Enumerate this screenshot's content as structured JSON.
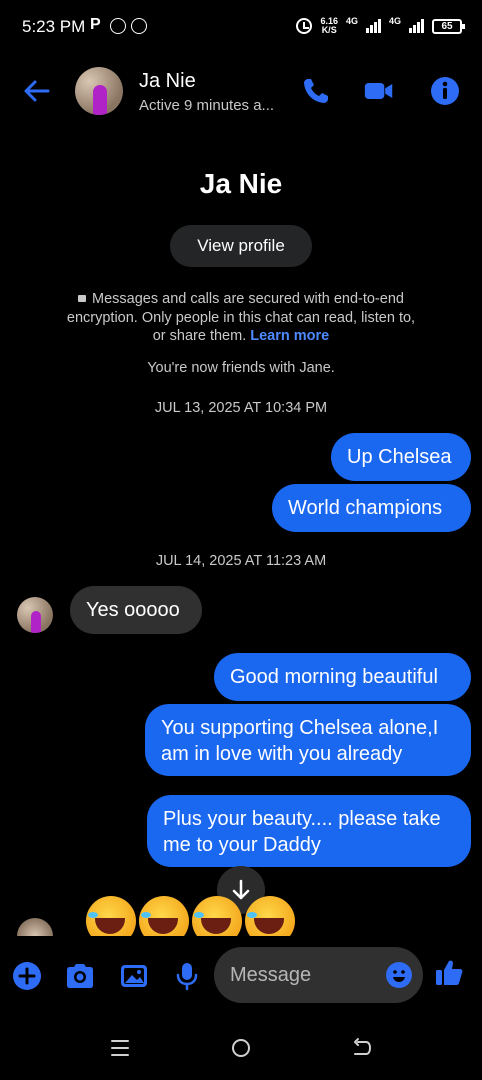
{
  "status_bar": {
    "time": "5:23 PM",
    "p_label": "P",
    "speed_value": "6.16",
    "speed_unit": "K/S",
    "net1": "4G",
    "net2": "4G",
    "battery": "65"
  },
  "header": {
    "name": "Ja Nie",
    "status": "Active 9 minutes a..."
  },
  "profile": {
    "name": "Ja Nie",
    "view_profile_label": "View profile",
    "encryption_text": "Messages and calls are secured with end-to-end encryption. Only people in this chat can read, listen to, or share them.",
    "learn_more": "Learn more",
    "friends_note": "You're now friends with Jane."
  },
  "conversation": {
    "timestamp_1": "JUL 13, 2025 AT 10:34 PM",
    "timestamp_2": "JUL 14, 2025 AT 11:23 AM",
    "messages": [
      {
        "from": "me",
        "text": "Up Chelsea"
      },
      {
        "from": "me",
        "text": "World champions"
      },
      {
        "from": "them",
        "text": "Yes ooooo"
      },
      {
        "from": "me",
        "text": "Good morning beautiful"
      },
      {
        "from": "me",
        "text": "You supporting Chelsea alone,I am in love with you already"
      },
      {
        "from": "me",
        "text": "Plus your beauty.... please take me to your Daddy"
      },
      {
        "from": "them",
        "text": "🤣🤣🤣🤣"
      }
    ]
  },
  "composer": {
    "placeholder": "Message"
  },
  "colors": {
    "accent": "#1a67f0",
    "icon_blue": "#2f6cf6",
    "incoming_bubble": "#303030",
    "background": "#000000"
  },
  "icons": [
    "back-arrow-icon",
    "phone-icon",
    "video-icon",
    "info-icon",
    "plus-icon",
    "camera-icon",
    "image-icon",
    "microphone-icon",
    "emoji-icon",
    "like-icon",
    "arrow-down-icon",
    "menu-icon",
    "home-icon",
    "return-icon"
  ]
}
